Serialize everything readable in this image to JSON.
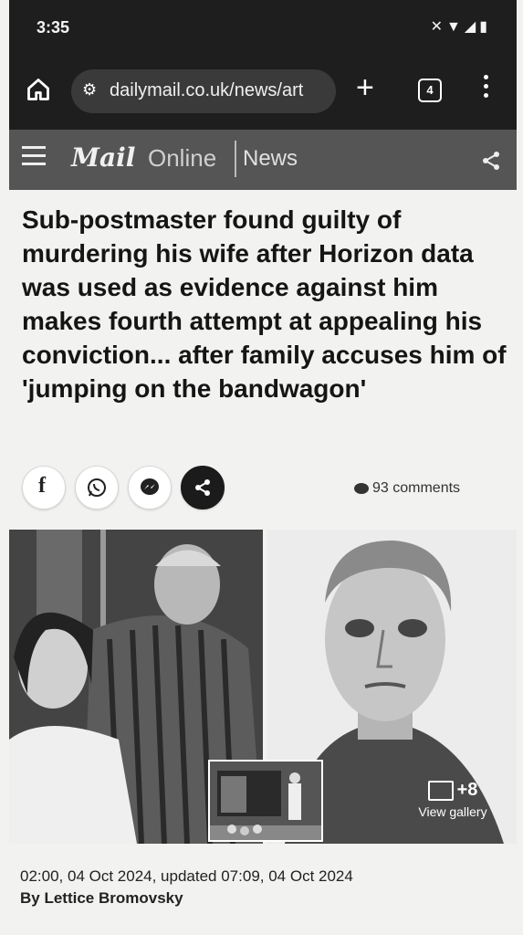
{
  "status_bar": {
    "time": "3:35"
  },
  "browser": {
    "url": "dailymail.co.uk/news/art",
    "tab_count": "4",
    "new_tab_label": "+"
  },
  "site_header": {
    "logo_mail": "Mail",
    "logo_online": "Online",
    "section": "News"
  },
  "article": {
    "headline": "Sub-postmaster found guilty of murdering his wife after Horizon data was used as evidence against him makes fourth attempt at appealing his conviction... after family accuses him of 'jumping on the bandwagon'",
    "comments": "93 comments",
    "gallery_count": "+8",
    "gallery_label": "View gallery",
    "dateline": "02:00, 04 Oct 2024, updated 07:09, 04 Oct 2024",
    "byline": "By Lettice Bromovsky"
  },
  "share_buttons": [
    {
      "icon": "facebook-icon",
      "glyph": "f"
    },
    {
      "icon": "whatsapp-icon"
    },
    {
      "icon": "messenger-icon"
    },
    {
      "icon": "share-icon"
    }
  ]
}
